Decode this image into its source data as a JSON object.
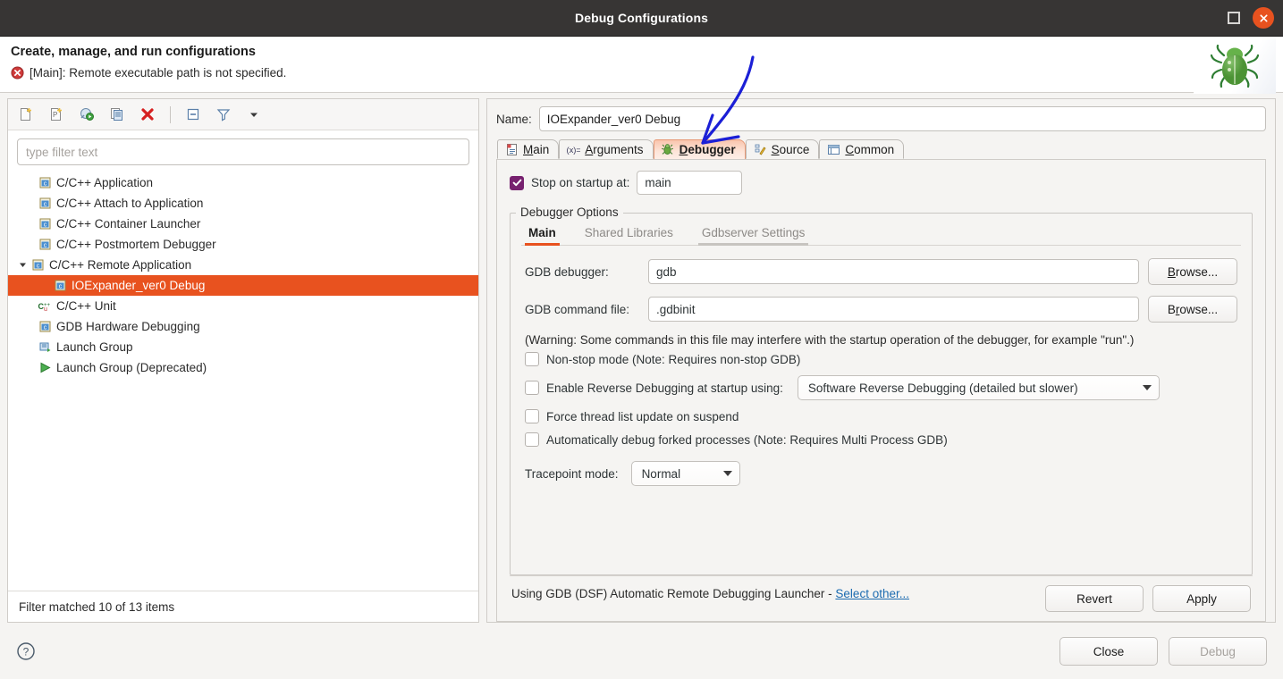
{
  "titlebar": {
    "title": "Debug Configurations",
    "maximize_label": "Maximize",
    "close_label": "Close"
  },
  "banner": {
    "heading": "Create, manage, and run configurations",
    "error_text": "[Main]: Remote executable path is not specified.",
    "error_icon": "error-circle-icon",
    "decoration_icon": "green-bug-icon"
  },
  "left": {
    "toolbar": [
      {
        "name": "new-launch-configuration-button",
        "icon": "new-document-icon",
        "tooltip": "New launch configuration"
      },
      {
        "name": "new-prototype-button",
        "icon": "new-prototype-icon",
        "tooltip": "New prototype"
      },
      {
        "name": "new-launch-group-button",
        "icon": "new-launch-group-icon",
        "tooltip": "New launch group"
      },
      {
        "name": "duplicate-button",
        "icon": "duplicate-icon",
        "tooltip": "Duplicate"
      },
      {
        "name": "delete-button",
        "icon": "delete-x-icon",
        "tooltip": "Delete"
      },
      {
        "name": "collapse-all-button",
        "icon": "collapse-all-icon",
        "tooltip": "Collapse All"
      },
      {
        "name": "filter-button",
        "icon": "filter-funnel-icon",
        "tooltip": "Filter"
      },
      {
        "name": "view-menu-button",
        "icon": "chevron-down-icon",
        "tooltip": "View Menu"
      }
    ],
    "filter_placeholder": "type filter text",
    "tree": [
      {
        "label": "C/C++ Application",
        "icon": "c-app-icon",
        "indent": 1,
        "expanded": null,
        "selected": false
      },
      {
        "label": "C/C++ Attach to Application",
        "icon": "c-app-icon",
        "indent": 1,
        "expanded": null,
        "selected": false
      },
      {
        "label": "C/C++ Container Launcher",
        "icon": "c-app-icon",
        "indent": 1,
        "expanded": null,
        "selected": false
      },
      {
        "label": "C/C++ Postmortem Debugger",
        "icon": "c-app-icon",
        "indent": 1,
        "expanded": null,
        "selected": false
      },
      {
        "label": "C/C++ Remote Application",
        "icon": "c-app-icon",
        "indent": 0,
        "expanded": true,
        "selected": false
      },
      {
        "label": "IOExpander_ver0 Debug",
        "icon": "c-config-icon",
        "indent": 2,
        "expanded": null,
        "selected": true
      },
      {
        "label": "C/C++ Unit",
        "icon": "cpp-unit-icon",
        "indent": 1,
        "expanded": null,
        "selected": false
      },
      {
        "label": "GDB Hardware Debugging",
        "icon": "c-app-icon",
        "indent": 1,
        "expanded": null,
        "selected": false
      },
      {
        "label": "Launch Group",
        "icon": "launch-group-icon",
        "indent": 1,
        "expanded": null,
        "selected": false
      },
      {
        "label": "Launch Group (Deprecated)",
        "icon": "green-play-icon",
        "indent": 1,
        "expanded": null,
        "selected": false
      }
    ],
    "status": "Filter matched 10 of 13 items"
  },
  "right": {
    "name_label": "Name:",
    "name_value": "IOExpander_ver0 Debug",
    "tabs": [
      {
        "label": "Main",
        "icon": "main-document-icon",
        "active": false
      },
      {
        "label": "Arguments",
        "icon": "arguments-variable-icon",
        "active": false
      },
      {
        "label": "Debugger",
        "icon": "debugger-bug-icon",
        "active": true
      },
      {
        "label": "Source",
        "icon": "source-edit-icon",
        "active": false
      },
      {
        "label": "Common",
        "icon": "common-table-icon",
        "active": false
      }
    ],
    "stop_on_startup": {
      "checked": true,
      "label": "Stop on startup at:",
      "value": "main"
    },
    "group_title": "Debugger Options",
    "inner_tabs": [
      {
        "label": "Main",
        "state": "active"
      },
      {
        "label": "Shared Libraries",
        "state": "normal"
      },
      {
        "label": "Gdbserver Settings",
        "state": "hover"
      }
    ],
    "fields": [
      {
        "label": "GDB debugger:",
        "value": "gdb",
        "button": "Browse...",
        "mnemonic_index": 0
      },
      {
        "label": "GDB command file:",
        "value": ".gdbinit",
        "button": "Browse...",
        "mnemonic_index": 1
      }
    ],
    "warning": "(Warning: Some commands in this file may interfere with the startup operation of the debugger, for example \"run\".)",
    "checkboxes": [
      {
        "label": "Non-stop mode (Note: Requires non-stop GDB)",
        "checked": false
      },
      {
        "label": "Enable Reverse Debugging at startup using:",
        "checked": false
      },
      {
        "label": "Force thread list update on suspend",
        "checked": false
      },
      {
        "label": "Automatically debug forked processes (Note: Requires Multi Process GDB)",
        "checked": false
      }
    ],
    "reverse_combo_value": "Software Reverse Debugging (detailed but slower)",
    "tracepoint_label": "Tracepoint mode:",
    "tracepoint_value": "Normal",
    "launcher_prefix": "Using GDB (DSF) Automatic Remote Debugging Launcher - ",
    "launcher_link": "Select other...",
    "revert_label": "Revert",
    "apply_label": "Apply"
  },
  "footer": {
    "help_icon": "help-question-icon",
    "close_label": "Close",
    "debug_label": "Debug"
  },
  "annotation": {
    "type": "hand-drawn-arrow",
    "color": "#1b1fd6",
    "points_to": "Debugger tab"
  },
  "colors": {
    "selection": "#e8521f",
    "accent": "#e8521f",
    "titlebar": "#37353a",
    "close_button": "#e8521f",
    "checkbox_checked": "#77216f",
    "link": "#1c6bb0",
    "error": "#cc3333",
    "annotation": "#1b1fd6"
  }
}
